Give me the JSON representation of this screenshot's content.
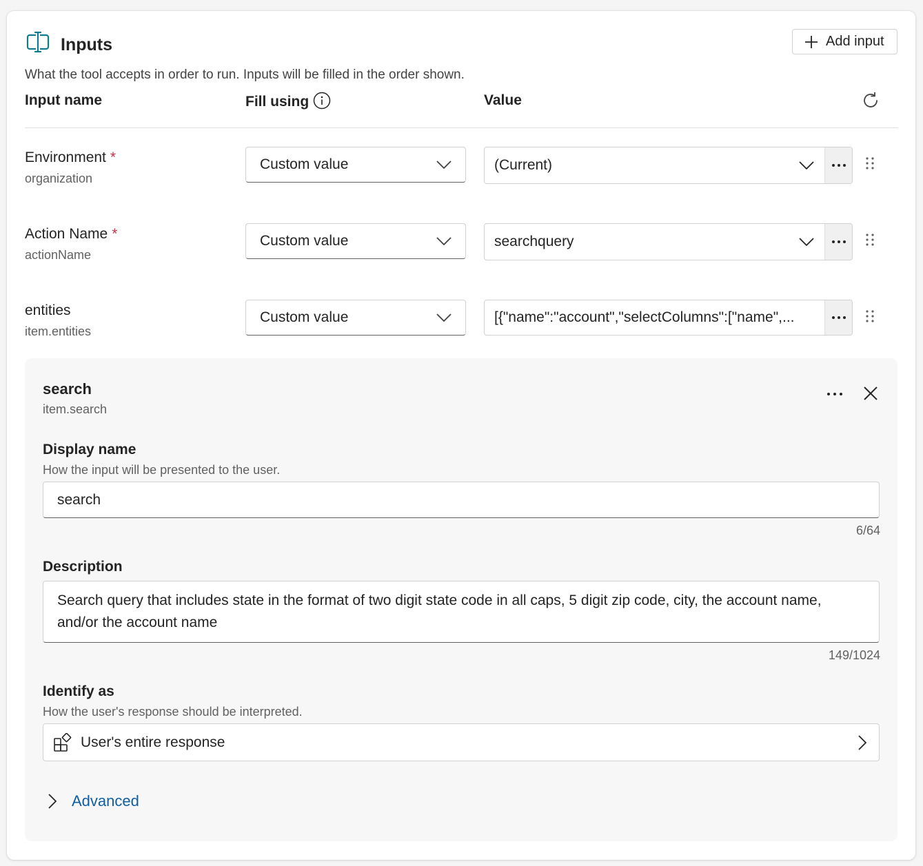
{
  "header": {
    "icon": "input-field-icon",
    "title": "Inputs",
    "add_input_label": "Add input",
    "description": "What the tool accepts in order to run. Inputs will be filled in the order shown."
  },
  "columns": {
    "input_name": "Input name",
    "fill_using": "Fill using",
    "value": "Value"
  },
  "rows": [
    {
      "name": "Environment",
      "required": "*",
      "key": "organization",
      "fill": "Custom value",
      "value": "(Current)"
    },
    {
      "name": "Action Name",
      "required": "*",
      "key": "actionName",
      "fill": "Custom value",
      "value": "searchquery"
    },
    {
      "name": "entities",
      "required": "",
      "key": "item.entities",
      "fill": "Custom value",
      "value": "[{\"name\":\"account\",\"selectColumns\":[\"name\",..."
    }
  ],
  "panel": {
    "title": "search",
    "key": "item.search",
    "display_name": {
      "label": "Display name",
      "hint": "How the input will be presented to the user.",
      "value": "search",
      "counter": "6/64"
    },
    "description": {
      "label": "Description",
      "value": "Search query that includes state in the format of two digit state code in all caps, 5 digit zip code, city, the account name, and/or the account name",
      "counter": "149/1024"
    },
    "identify_as": {
      "label": "Identify as",
      "hint": "How the user's response should be interpreted.",
      "value": "User's entire response"
    },
    "advanced_label": "Advanced"
  },
  "colors": {
    "accent_icon": "#0f7b8c",
    "link": "#115ea3",
    "required": "#c4314b"
  }
}
